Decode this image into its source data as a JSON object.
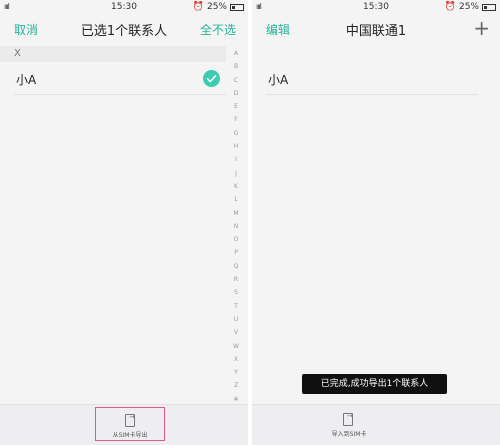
{
  "left": {
    "status": {
      "signal": "ıııl",
      "time": "15:30",
      "battery": "25%"
    },
    "nav": {
      "cancel": "取消",
      "title": "已选1个联系人",
      "select_all": "全不选"
    },
    "section_letter": "X",
    "contact": "小A",
    "index_letters": [
      "A",
      "B",
      "C",
      "D",
      "E",
      "F",
      "G",
      "H",
      "I",
      "J",
      "K",
      "L",
      "M",
      "N",
      "O",
      "P",
      "Q",
      "R",
      "S",
      "T",
      "U",
      "V",
      "W",
      "X",
      "Y",
      "Z",
      "#"
    ],
    "bottom_button": "从SIM卡导出"
  },
  "right": {
    "status": {
      "signal": "ıııl",
      "time": "15:30",
      "battery": "25%"
    },
    "nav": {
      "edit": "编辑",
      "title": "中国联通1",
      "add": "+"
    },
    "contact": "小A",
    "toast": "已完成,成功导出1个联系人",
    "bottom_button": "导入到SIM卡"
  },
  "colors": {
    "accent": "#23b39c",
    "highlight": "#e0578b"
  },
  "icons": [
    "wifi-icon",
    "alarm-icon",
    "battery-icon",
    "check-icon",
    "sim-export-icon",
    "sim-import-icon",
    "plus-icon"
  ]
}
